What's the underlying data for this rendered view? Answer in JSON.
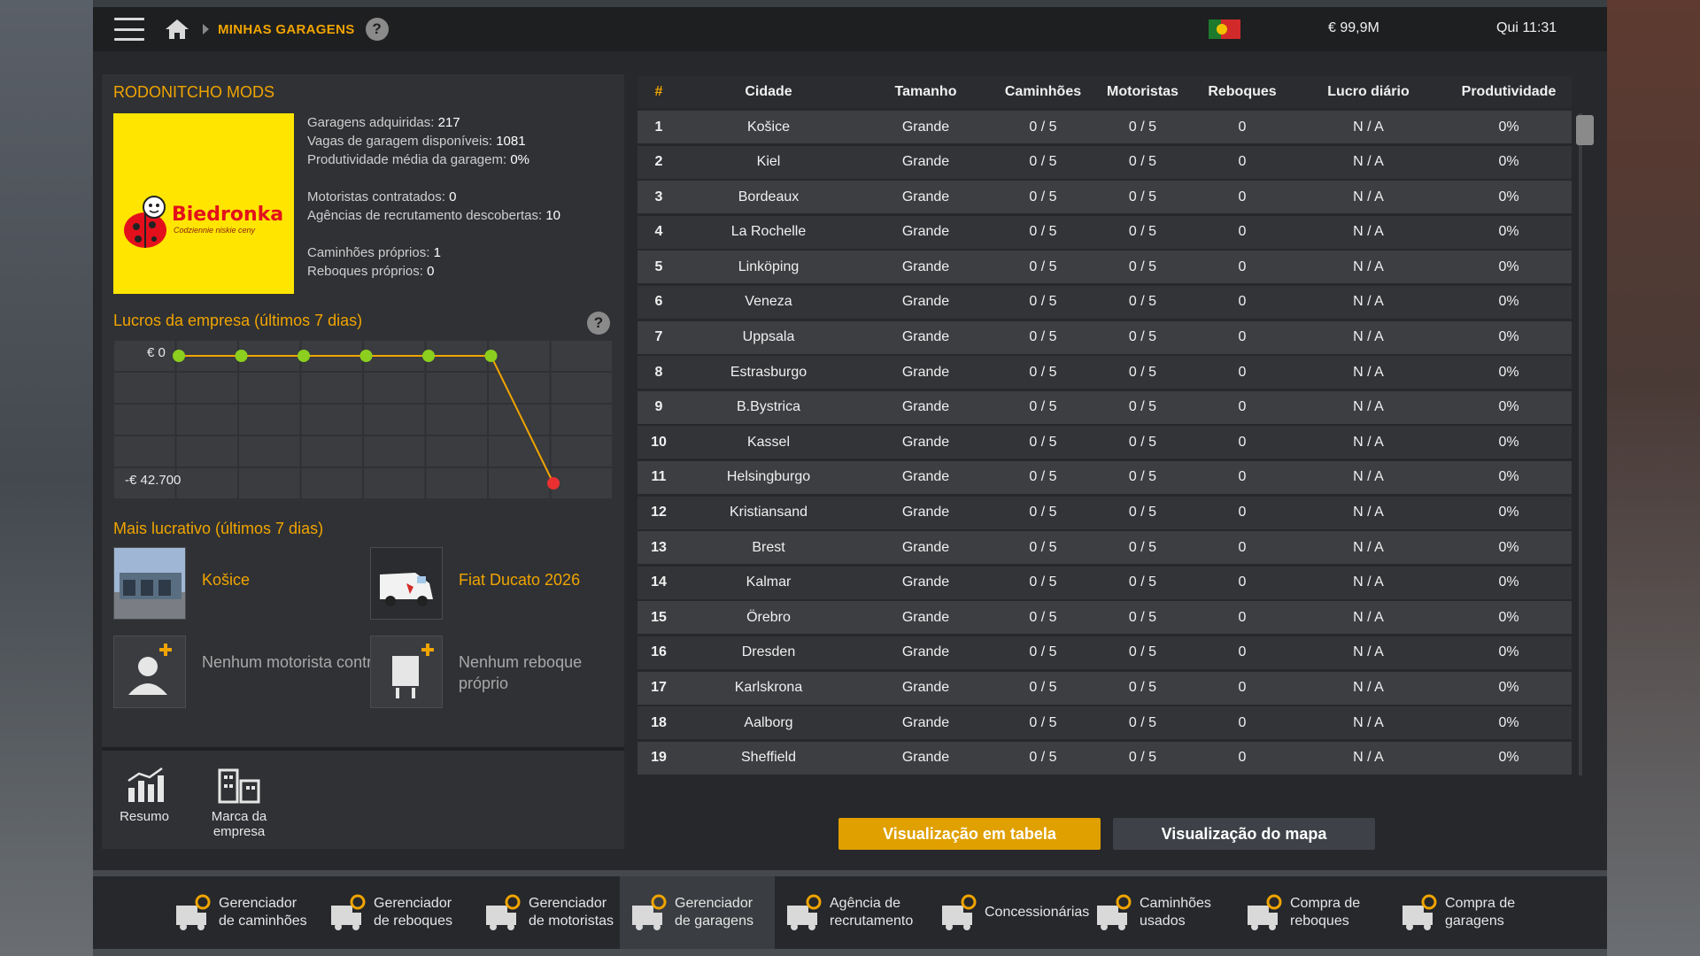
{
  "topbar": {
    "breadcrumb": "MINHAS GARAGENS",
    "help": "?",
    "money": "€ 99,9M",
    "clock": "Qui 11:31"
  },
  "company": {
    "name": "RODONITCHO MODS",
    "logo_text": "Biedronka",
    "logo_sub": "Codziennie niskie ceny",
    "stats": {
      "garagens_label": "Garagens adquiridas:",
      "garagens_value": "217",
      "vagas_label": "Vagas de garagem disponíveis:",
      "vagas_value": "1081",
      "produtividade_label": "Produtividade média da garagem:",
      "produtividade_value": "0%",
      "motoristas_label": "Motoristas contratados:",
      "motoristas_value": "0",
      "agencias_label": "Agências de recrutamento descobertas:",
      "agencias_value": "10",
      "caminhoes_label": "Caminhões próprios:",
      "caminhoes_value": "1",
      "reboques_label": "Reboques próprios:",
      "reboques_value": "0"
    }
  },
  "profits": {
    "title": "Lucros da empresa (últimos 7 dias)",
    "label_top": "€ 0",
    "label_bottom": "-€ 42.700"
  },
  "chart_data": {
    "type": "line",
    "title": "Lucros da empresa (últimos 7 dias)",
    "x": [
      1,
      2,
      3,
      4,
      5,
      6,
      7
    ],
    "values": [
      0,
      0,
      0,
      0,
      0,
      0,
      -42700
    ],
    "ylim": [
      -42700,
      0
    ],
    "grid": true,
    "colors": {
      "line": "#f0a400",
      "point": "#8ccf1e",
      "last_point": "#e83030"
    }
  },
  "lucrativo": {
    "title": "Mais lucrativo (últimos 7 dias)",
    "garage": "Košice",
    "truck": "Fiat Ducato 2026",
    "no_driver": "Nenhum motorista contratado",
    "no_trailer": "Nenhum reboque próprio"
  },
  "sub_nav": {
    "resumo": "Resumo",
    "marca": "Marca da empresa"
  },
  "table": {
    "headers": [
      "#",
      "Cidade",
      "Tamanho",
      "Caminhões",
      "Motoristas",
      "Reboques",
      "Lucro diário",
      "Produtividade"
    ],
    "rows": [
      [
        "1",
        "Košice",
        "Grande",
        "0 / 5",
        "0 / 5",
        "0",
        "N / A",
        "0%"
      ],
      [
        "2",
        "Kiel",
        "Grande",
        "0 / 5",
        "0 / 5",
        "0",
        "N / A",
        "0%"
      ],
      [
        "3",
        "Bordeaux",
        "Grande",
        "0 / 5",
        "0 / 5",
        "0",
        "N / A",
        "0%"
      ],
      [
        "4",
        "La Rochelle",
        "Grande",
        "0 / 5",
        "0 / 5",
        "0",
        "N / A",
        "0%"
      ],
      [
        "5",
        "Linköping",
        "Grande",
        "0 / 5",
        "0 / 5",
        "0",
        "N / A",
        "0%"
      ],
      [
        "6",
        "Veneza",
        "Grande",
        "0 / 5",
        "0 / 5",
        "0",
        "N / A",
        "0%"
      ],
      [
        "7",
        "Uppsala",
        "Grande",
        "0 / 5",
        "0 / 5",
        "0",
        "N / A",
        "0%"
      ],
      [
        "8",
        "Estrasburgo",
        "Grande",
        "0 / 5",
        "0 / 5",
        "0",
        "N / A",
        "0%"
      ],
      [
        "9",
        "B.Bystrica",
        "Grande",
        "0 / 5",
        "0 / 5",
        "0",
        "N / A",
        "0%"
      ],
      [
        "10",
        "Kassel",
        "Grande",
        "0 / 5",
        "0 / 5",
        "0",
        "N / A",
        "0%"
      ],
      [
        "11",
        "Helsingburgo",
        "Grande",
        "0 / 5",
        "0 / 5",
        "0",
        "N / A",
        "0%"
      ],
      [
        "12",
        "Kristiansand",
        "Grande",
        "0 / 5",
        "0 / 5",
        "0",
        "N / A",
        "0%"
      ],
      [
        "13",
        "Brest",
        "Grande",
        "0 / 5",
        "0 / 5",
        "0",
        "N / A",
        "0%"
      ],
      [
        "14",
        "Kalmar",
        "Grande",
        "0 / 5",
        "0 / 5",
        "0",
        "N / A",
        "0%"
      ],
      [
        "15",
        "Örebro",
        "Grande",
        "0 / 5",
        "0 / 5",
        "0",
        "N / A",
        "0%"
      ],
      [
        "16",
        "Dresden",
        "Grande",
        "0 / 5",
        "0 / 5",
        "0",
        "N / A",
        "0%"
      ],
      [
        "17",
        "Karlskrona",
        "Grande",
        "0 / 5",
        "0 / 5",
        "0",
        "N / A",
        "0%"
      ],
      [
        "18",
        "Aalborg",
        "Grande",
        "0 / 5",
        "0 / 5",
        "0",
        "N / A",
        "0%"
      ],
      [
        "19",
        "Sheffield",
        "Grande",
        "0 / 5",
        "0 / 5",
        "0",
        "N / A",
        "0%"
      ]
    ]
  },
  "view_buttons": {
    "table": "Visualização em tabela",
    "map": "Visualização do mapa"
  },
  "bottom_nav": [
    {
      "label": "Gerenciador de caminhões",
      "icon": "truck-gear-icon"
    },
    {
      "label": "Gerenciador de reboques",
      "icon": "trailer-gear-icon"
    },
    {
      "label": "Gerenciador de motoristas",
      "icon": "driver-gear-icon"
    },
    {
      "label": "Gerenciador de garagens",
      "icon": "garage-gear-icon"
    },
    {
      "label": "Agência de recrutamento",
      "icon": "recruitment-icon"
    },
    {
      "label": "Concessionárias",
      "icon": "dealer-icon"
    },
    {
      "label": "Caminhões usados",
      "icon": "used-truck-icon"
    },
    {
      "label": "Compra de reboques",
      "icon": "buy-trailer-icon"
    },
    {
      "label": "Compra de garagens",
      "icon": "buy-garage-icon"
    }
  ]
}
